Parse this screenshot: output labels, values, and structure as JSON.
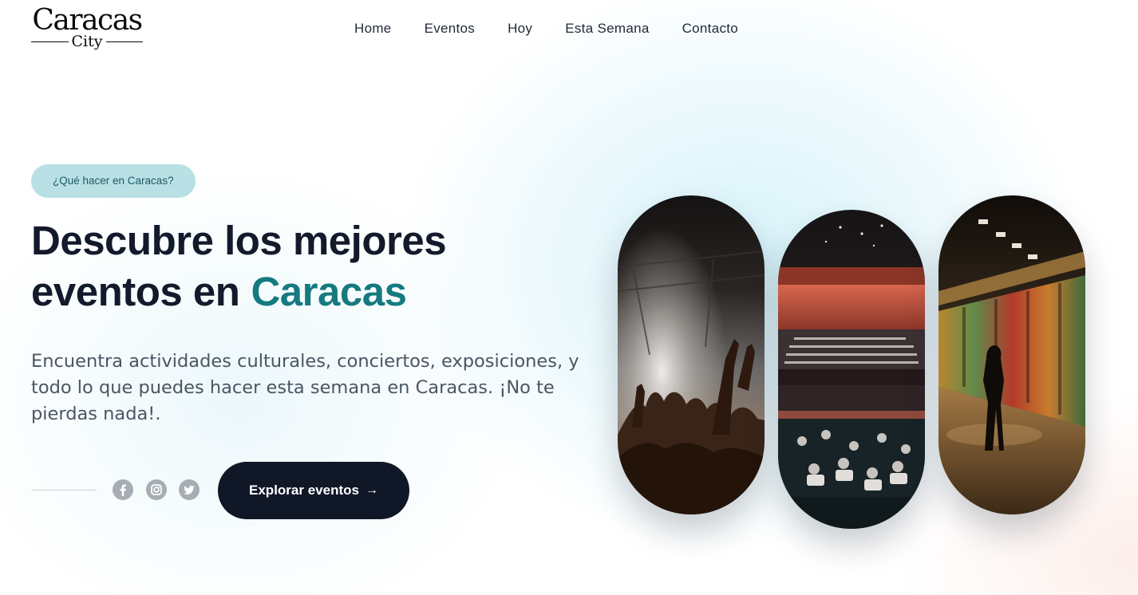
{
  "header": {
    "logo_main": "Caracas",
    "logo_sub": "City",
    "nav": [
      "Home",
      "Eventos",
      "Hoy",
      "Esta Semana",
      "Contacto"
    ]
  },
  "hero": {
    "tag": "¿Qué hacer en Caracas?",
    "headline_part1": "Descubre los mejores eventos en",
    "headline_accent": "Caracas",
    "description": "Encuentra actividades culturales, conciertos, exposiciones, y todo lo que puedes hacer esta semana en Caracas. ¡No te pierdas nada!.",
    "cta_label": "Explorar eventos",
    "cta_arrow": "→",
    "social_icons": [
      "facebook-icon",
      "instagram-icon",
      "twitter-icon"
    ]
  },
  "images": [
    {
      "name": "concert-crowd-photo"
    },
    {
      "name": "orchestra-theater-photo"
    },
    {
      "name": "art-gallery-photo"
    }
  ],
  "colors": {
    "accent": "#157a80",
    "dark": "#101727",
    "tag_bg": "#b9e0e4",
    "text_muted": "#4b5563"
  }
}
